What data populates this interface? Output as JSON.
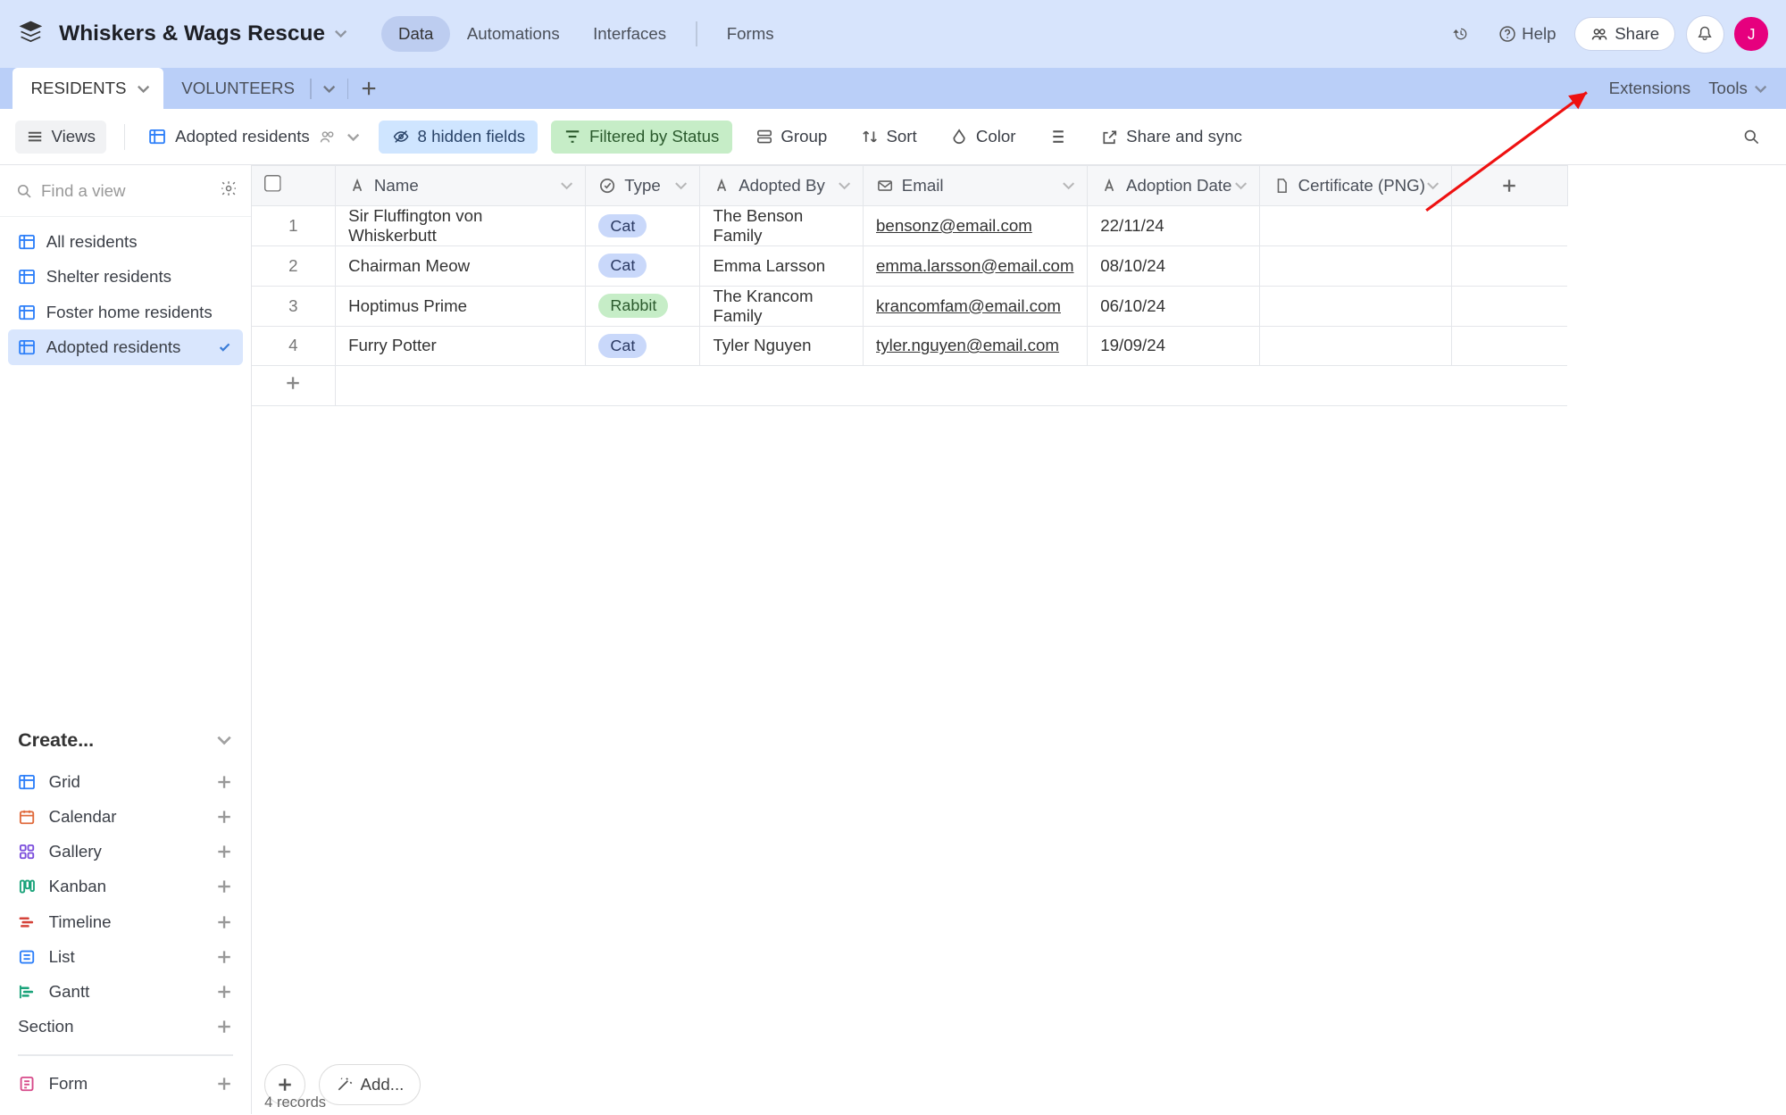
{
  "header": {
    "base_name": "Whiskers & Wags Rescue",
    "nav": {
      "data": "Data",
      "automations": "Automations",
      "interfaces": "Interfaces",
      "forms": "Forms"
    },
    "help": "Help",
    "share": "Share",
    "avatar_initial": "J"
  },
  "tables": {
    "active": "RESIDENTS",
    "other": "VOLUNTEERS",
    "extensions": "Extensions",
    "tools": "Tools"
  },
  "toolbar": {
    "views": "Views",
    "view_name": "Adopted residents",
    "hidden_fields": "8 hidden fields",
    "filtered": "Filtered by Status",
    "group": "Group",
    "sort": "Sort",
    "color": "Color",
    "share_sync": "Share and sync"
  },
  "sidebar": {
    "find_placeholder": "Find a view",
    "views": [
      {
        "label": "All residents"
      },
      {
        "label": "Shelter residents"
      },
      {
        "label": "Foster home residents"
      },
      {
        "label": "Adopted residents"
      }
    ],
    "create_label": "Create...",
    "create_options": {
      "grid": "Grid",
      "calendar": "Calendar",
      "gallery": "Gallery",
      "kanban": "Kanban",
      "timeline": "Timeline",
      "list": "List",
      "gantt": "Gantt",
      "section": "Section",
      "form": "Form"
    }
  },
  "grid": {
    "columns": {
      "name": "Name",
      "type": "Type",
      "adopted_by": "Adopted By",
      "email": "Email",
      "adoption_date": "Adoption Date",
      "certificate": "Certificate (PNG)"
    },
    "rows": [
      {
        "n": "1",
        "name": "Sir Fluffington von Whiskerbutt",
        "type": "Cat",
        "type_class": "cat",
        "adopted_by": "The Benson Family",
        "email": "bensonz@email.com",
        "date": "22/11/24"
      },
      {
        "n": "2",
        "name": "Chairman Meow",
        "type": "Cat",
        "type_class": "cat",
        "adopted_by": "Emma Larsson",
        "email": "emma.larsson@email.com",
        "date": "08/10/24"
      },
      {
        "n": "3",
        "name": "Hoptimus Prime",
        "type": "Rabbit",
        "type_class": "rabbit",
        "adopted_by": "The Krancom Family",
        "email": "krancomfam@email.com",
        "date": "06/10/24"
      },
      {
        "n": "4",
        "name": "Furry Potter",
        "type": "Cat",
        "type_class": "cat",
        "adopted_by": "Tyler Nguyen",
        "email": "tyler.nguyen@email.com",
        "date": "19/09/24"
      }
    ],
    "footer_add": "Add...",
    "record_count": "4 records"
  }
}
